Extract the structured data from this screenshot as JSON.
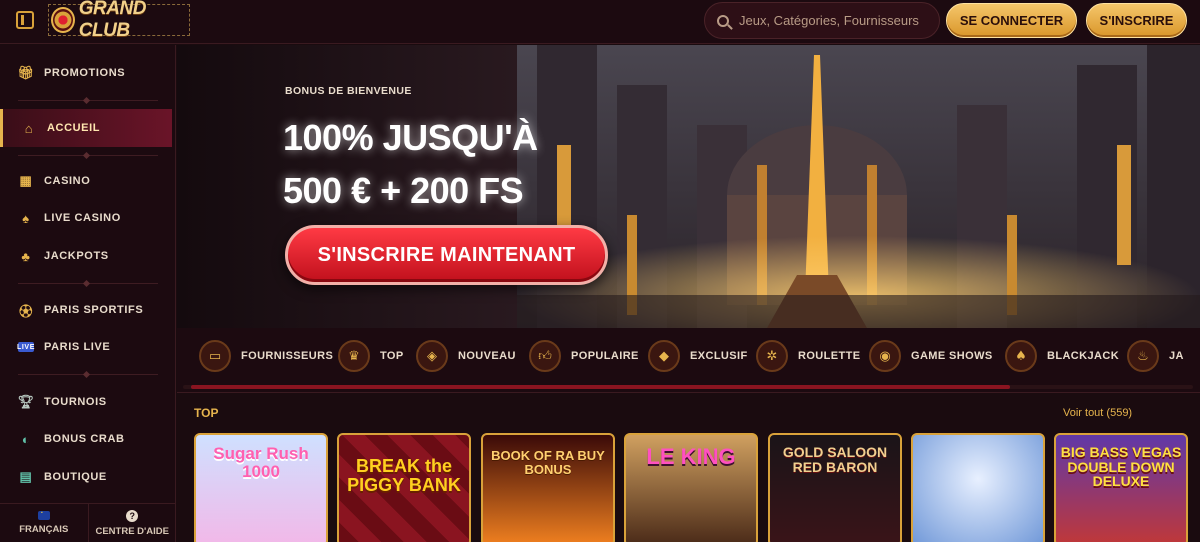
{
  "header": {
    "logo_text": "GRAND CLUB",
    "search_placeholder": "Jeux, Catégories, Fournisseurs",
    "login_label": "SE CONNECTER",
    "register_label": "S'INSCRIRE"
  },
  "sidebar": {
    "items": [
      {
        "label": "PROMOTIONS",
        "icon": "gift-icon"
      },
      {
        "label": "ACCUEIL",
        "icon": "home-icon",
        "active": true
      },
      {
        "label": "CASINO",
        "icon": "slot-machine-icon"
      },
      {
        "label": "LIVE CASINO",
        "icon": "spade-icon"
      },
      {
        "label": "JACKPOTS",
        "icon": "clover-icon"
      },
      {
        "label": "PARIS SPORTIFS",
        "icon": "soccer-ball-icon"
      },
      {
        "label": "PARIS LIVE",
        "icon": "live-icon"
      },
      {
        "label": "TOURNOIS",
        "icon": "trophy-icon"
      },
      {
        "label": "BONUS CRAB",
        "icon": "claw-icon"
      },
      {
        "label": "BOUTIQUE",
        "icon": "shop-icon"
      }
    ],
    "footer": {
      "language_label": "FRANÇAIS",
      "help_label": "CENTRE D'AIDE"
    }
  },
  "hero": {
    "badge": "BONUS DE BIENVENUE",
    "title_line1": "100% JUSQU'À",
    "title_line2": "500 € + 200 FS",
    "cta_label": "S'INSCRIRE MAINTENANT"
  },
  "categories": [
    {
      "label": "FOURNISSEURS",
      "icon": "folder-icon"
    },
    {
      "label": "TOP",
      "icon": "crown-icon"
    },
    {
      "label": "NOUVEAU",
      "icon": "tag-icon"
    },
    {
      "label": "POPULAIRE",
      "icon": "thumbs-up-icon"
    },
    {
      "label": "EXCLUSIF",
      "icon": "diamond-icon"
    },
    {
      "label": "ROULETTE",
      "icon": "roulette-icon"
    },
    {
      "label": "GAME SHOWS",
      "icon": "game-show-icon"
    },
    {
      "label": "BLACKJACK",
      "icon": "spade-icon"
    },
    {
      "label": "JA",
      "icon": "flame-icon"
    }
  ],
  "top_section": {
    "title": "TOP",
    "see_all": "Voir tout (559)"
  },
  "games": [
    {
      "name": "Sugar Rush 1000",
      "colors": [
        "#cfe0ff",
        "#f2b8e8"
      ]
    },
    {
      "name": "BREAK the PIGGY BANK",
      "colors": [
        "#6a0c14",
        "#c02838"
      ]
    },
    {
      "name": "BOOK OF RA BUY BONUS",
      "colors": [
        "#3a0a08",
        "#f08020"
      ]
    },
    {
      "name": "LE KING",
      "colors": [
        "#d0a060",
        "#4a2a18"
      ]
    },
    {
      "name": "GOLD SALOON RED BARON",
      "colors": [
        "#1a1418",
        "#3a1418"
      ]
    },
    {
      "name": "",
      "colors": [
        "#bcd8f8",
        "#7098d8"
      ]
    },
    {
      "name": "BIG BASS VEGAS DOUBLE DOWN DELUXE",
      "colors": [
        "#6038a8",
        "#c03838"
      ]
    }
  ]
}
